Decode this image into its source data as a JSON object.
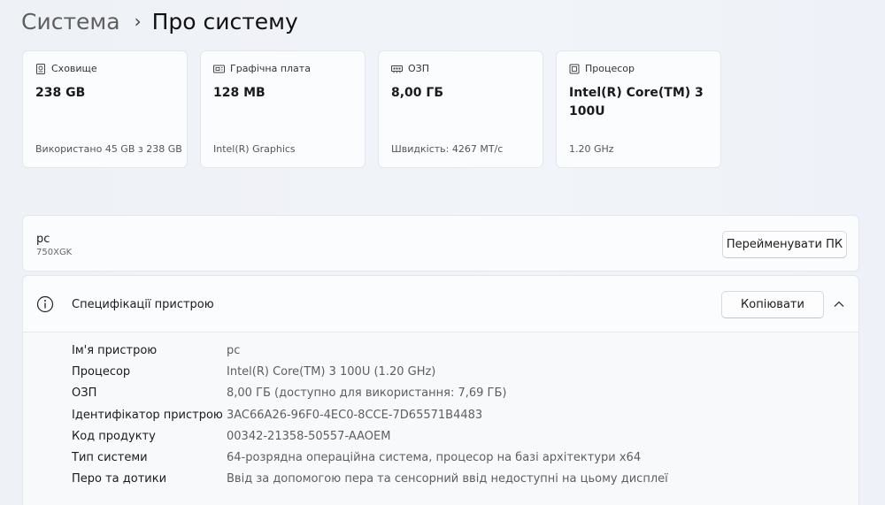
{
  "breadcrumb": {
    "parent": "Система",
    "separator": "›",
    "current": "Про систему"
  },
  "tiles": [
    {
      "icon": "storage-icon",
      "label": "Сховище",
      "value": "238 GB",
      "sub": "Використано 45 GB з 238 GB"
    },
    {
      "icon": "graphics-card-icon",
      "label": "Графічна плата",
      "value": "128 MB",
      "sub": "Intel(R) Graphics"
    },
    {
      "icon": "ram-icon",
      "label": "ОЗП",
      "value": "8,00 ГБ",
      "sub": "Швидкість: 4267 МТ/с"
    },
    {
      "icon": "processor-icon",
      "label": "Процесор",
      "value": "Intel(R) Core(TM) 3 100U",
      "sub": "1.20 GHz"
    }
  ],
  "pc": {
    "name": "pc",
    "model": "750XGK",
    "rename_label": "Перейменувати ПК"
  },
  "specs": {
    "title": "Специфікації пристрою",
    "copy_label": "Копіювати",
    "rows": [
      {
        "label": "Ім'я пристрою",
        "value": "pc"
      },
      {
        "label": "Процесор",
        "value": "Intel(R) Core(TM) 3 100U (1.20 GHz)"
      },
      {
        "label": "ОЗП",
        "value": "8,00 ГБ (доступно для використання: 7,69 ГБ)"
      },
      {
        "label": "Ідентифікатор пристрою",
        "value": "3AC66A26-96F0-4EC0-8CCE-7D65571B4483"
      },
      {
        "label": "Код продукту",
        "value": "00342-21358-50557-AAOEM"
      },
      {
        "label": "Тип системи",
        "value": "64-розрядна операційна система, процесор на базі архітектури x64"
      },
      {
        "label": "Перо та дотики",
        "value": "Ввід за допомогою пера та сенсорний ввід недоступні на цьому дисплеї"
      }
    ]
  }
}
